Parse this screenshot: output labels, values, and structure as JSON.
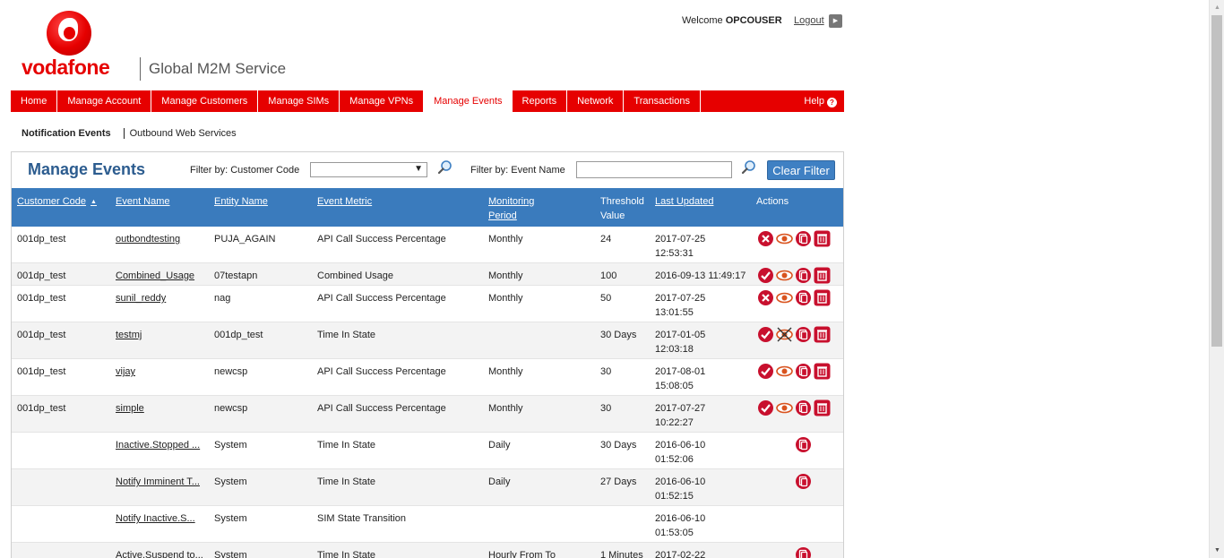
{
  "header": {
    "brand": "vodafone",
    "tagline": "Global M2M Service",
    "welcome_prefix": "Welcome",
    "username": "OPCOUSER",
    "logout": "Logout"
  },
  "nav": {
    "items": [
      "Home",
      "Manage Account",
      "Manage Customers",
      "Manage SIMs",
      "Manage VPNs",
      "Manage Events",
      "Reports",
      "Network",
      "Transactions"
    ],
    "active": "Manage Events",
    "help": "Help",
    "help_icon": "question-icon"
  },
  "subnav": {
    "active": "Notification Events",
    "other": "Outbound Web Services"
  },
  "panel": {
    "title": "Manage Events",
    "filter_customer_label": "Filter by: Customer Code",
    "filter_customer_value": "",
    "filter_event_label": "Filter by: Event Name",
    "filter_event_value": "",
    "clear_filter": "Clear Filter"
  },
  "table": {
    "headers": {
      "customer_code": "Customer Code",
      "event_name": "Event Name",
      "entity_name": "Entity Name",
      "event_metric": "Event Metric",
      "monitoring_period_1": "Monitoring",
      "monitoring_period_2": "Period",
      "threshold_1": "Threshold",
      "threshold_2": "Value",
      "last_updated": "Last Updated",
      "actions": "Actions"
    },
    "rows": [
      {
        "customer": "001dp_test",
        "event": "outbondtesting",
        "entity": "PUJA_AGAIN",
        "metric": "API Call Success Percentage",
        "period": "Monthly",
        "threshold": "24",
        "updated_1": "2017-07-25",
        "updated_2": "12:53:31",
        "status": "disable",
        "view": true,
        "copy": true,
        "delete": true
      },
      {
        "customer": "001dp_test",
        "event": "Combined_Usage",
        "entity": "07testapn",
        "metric": "Combined Usage",
        "period": "Monthly",
        "threshold": "100",
        "updated_1": "2016-09-13 11:49:17",
        "updated_2": "",
        "status": "enable",
        "view": true,
        "copy": true,
        "delete": true
      },
      {
        "customer": "001dp_test",
        "event": "sunil_reddy",
        "entity": "nag",
        "metric": "API Call Success Percentage",
        "period": "Monthly",
        "threshold": "50",
        "updated_1": "2017-07-25",
        "updated_2": "13:01:55",
        "status": "disable",
        "view": true,
        "copy": true,
        "delete": true
      },
      {
        "customer": "001dp_test",
        "event": "testmj",
        "entity": "001dp_test",
        "metric": "Time In State",
        "period": "",
        "threshold": "30 Days",
        "updated_1": "2017-01-05",
        "updated_2": "12:03:18",
        "status": "enable",
        "view": false,
        "copy": true,
        "delete": true
      },
      {
        "customer": "001dp_test",
        "event": "vijay",
        "entity": "newcsp",
        "metric": "API Call Success Percentage",
        "period": "Monthly",
        "threshold": "30",
        "updated_1": "2017-08-01",
        "updated_2": "15:08:05",
        "status": "enable",
        "view": true,
        "copy": true,
        "delete": true
      },
      {
        "customer": "001dp_test",
        "event": "simple",
        "entity": "newcsp",
        "metric": "API Call Success Percentage",
        "period": "Monthly",
        "threshold": "30",
        "updated_1": "2017-07-27",
        "updated_2": "10:22:27",
        "status": "enable",
        "view": true,
        "copy": true,
        "delete": true
      },
      {
        "customer": "",
        "event": "Inactive.Stopped ...",
        "entity": "System",
        "metric": "Time In State",
        "period": "Daily",
        "threshold": "30 Days",
        "updated_1": "2016-06-10",
        "updated_2": "01:52:06",
        "status": "",
        "view": false,
        "copy": true,
        "delete": false
      },
      {
        "customer": "",
        "event": "Notify Imminent T...",
        "entity": "System",
        "metric": "Time In State",
        "period": "Daily",
        "threshold": "27 Days",
        "updated_1": "2016-06-10",
        "updated_2": "01:52:15",
        "status": "",
        "view": false,
        "copy": true,
        "delete": false
      },
      {
        "customer": "",
        "event": "Notify Inactive.S...",
        "entity": "System",
        "metric": "SIM State Transition",
        "period": "",
        "threshold": "",
        "updated_1": "2016-06-10",
        "updated_2": "01:53:05",
        "status": "",
        "view": false,
        "copy": false,
        "delete": false
      },
      {
        "customer": "",
        "event": "Active.Suspend to...",
        "entity": "System",
        "metric": "Time In State",
        "period": "Hourly From To",
        "threshold": "1 Minutes",
        "updated_1": "2017-02-22",
        "updated_2": "",
        "status": "",
        "view": false,
        "copy": true,
        "delete": false
      }
    ]
  },
  "colors": {
    "brand_red": "#e60000",
    "header_blue": "#3a7bbd",
    "title_blue": "#2c5c8f",
    "button_blue": "#3f80c3"
  }
}
